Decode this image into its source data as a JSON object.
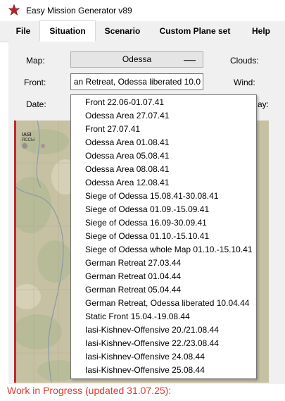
{
  "window": {
    "title": "Easy Mission Generator v89",
    "icon": "star-icon"
  },
  "tabs": [
    {
      "label": "File"
    },
    {
      "label": "Situation",
      "active": true
    },
    {
      "label": "Scenario"
    },
    {
      "label": "Custom Plane set"
    },
    {
      "label": "Help"
    }
  ],
  "form": {
    "map_label": "Map:",
    "map_value": "Odessa",
    "clouds_label": "Clouds:",
    "front_label": "Front:",
    "front_value": "an Retreat, Odessa liberated 10.0",
    "wind_label": "Wind:",
    "date_label": "Date:",
    "day_label": "ay:"
  },
  "map": {
    "city_label": "IASI",
    "city_sub": "ЯССЫ"
  },
  "dropdown": {
    "items": [
      "Front 22.06-01.07.41",
      "Odessa Area 27.07.41",
      "Front 27.07.41",
      "Odessa Area 01.08.41",
      "Odessa Area 05.08.41",
      "Odessa Area 08.08.41",
      "Odessa Area 12.08.41",
      "Siege of Odessa 15.08.41-30.08.41",
      "Siege of Odessa 01.09.-15.09.41",
      "Siege of Odessa 16.09-30.09.41",
      "Siege of Odessa 01.10.-15.10.41",
      "Siege of Odessa whole Map 01.10.-15.10.41",
      "German Retreat 27.03.44",
      "German Retreat 01.04.44",
      "German Retreat 05.04.44",
      "German Retreat, Odessa liberated 10.04.44",
      "Static Front 15.04.-19.08.44",
      "Iasi-Kishnev-Offensive 20./21.08.44",
      "Iasi-Kishnev-Offensive 22./23.08.44",
      "Iasi-Kishnev-Offensive 24.08.44",
      "Iasi-Kishnev-Offensive 25.08.44"
    ]
  },
  "footer": {
    "status": "Work in Progress (updated 31.07.25):"
  },
  "colors": {
    "accent_red": "#c1272d",
    "footer_red": "#e23b2e"
  }
}
